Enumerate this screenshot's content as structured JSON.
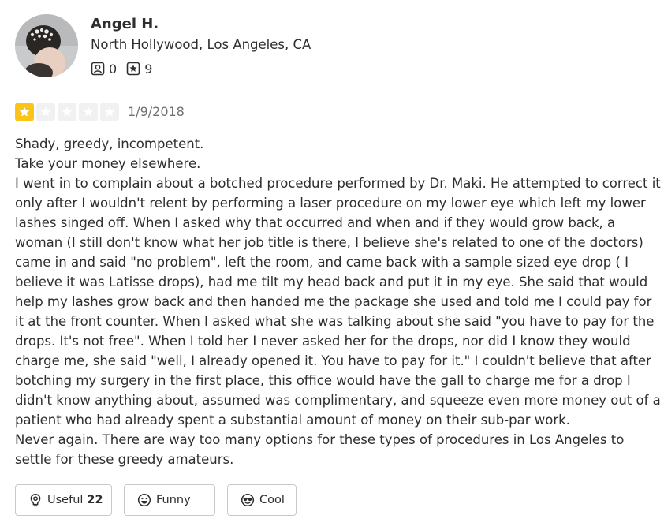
{
  "user": {
    "name": "Angel H.",
    "location": "North Hollywood, Los Angeles, CA",
    "stats": {
      "friends": {
        "icon": "friends-icon",
        "value": "0"
      },
      "reviews": {
        "icon": "review-star-icon",
        "value": "9"
      }
    }
  },
  "review": {
    "rating": 1,
    "rating_max": 5,
    "date": "1/9/2018",
    "text": "Shady, greedy, incompetent.\nTake your money elsewhere.\nI went in to complain about a botched procedure performed by Dr. Maki. He attempted to correct it only after I wouldn't relent by performing a laser procedure on my lower eye which left my lower lashes singed off. When I asked why that occurred and when and if they would grow back, a woman (I still don't know what her job title is there, I believe she's related to one of the doctors) came in and said \"no problem\", left the room, and came back with a sample sized eye drop ( I believe it was Latisse drops), had me tilt my head back and put it in my eye. She said that would help my lashes grow back and then handed me the package she used and told me I could pay for it at the front counter. When I asked what she was talking about she said \"you have to pay for the drops. It's not free\". When I told her I never asked her for the drops, nor did I know they would charge me, she said \"well, I already opened it. You have to pay for it.\" I couldn't believe that after botching my surgery in the first place, this office would have the gall to charge me for a drop I didn't know anything about, assumed was complimentary, and squeeze even more money out of a patient who had already spent a substantial amount of money on their sub-par work.\nNever again. There are way too many options for these types of procedures in Los Angeles to settle for these greedy amateurs."
  },
  "reactions": {
    "useful": {
      "label": "Useful",
      "count": "22",
      "icon": "lightbulb-icon"
    },
    "funny": {
      "label": "Funny",
      "icon": "smile-icon"
    },
    "cool": {
      "label": "Cool",
      "icon": "sunglasses-icon"
    }
  },
  "colors": {
    "star_filled": "#fcc419",
    "star_empty": "#f1f1f2",
    "text": "#2d2e2f",
    "muted": "#6e7072",
    "border": "#c8c9ca"
  }
}
